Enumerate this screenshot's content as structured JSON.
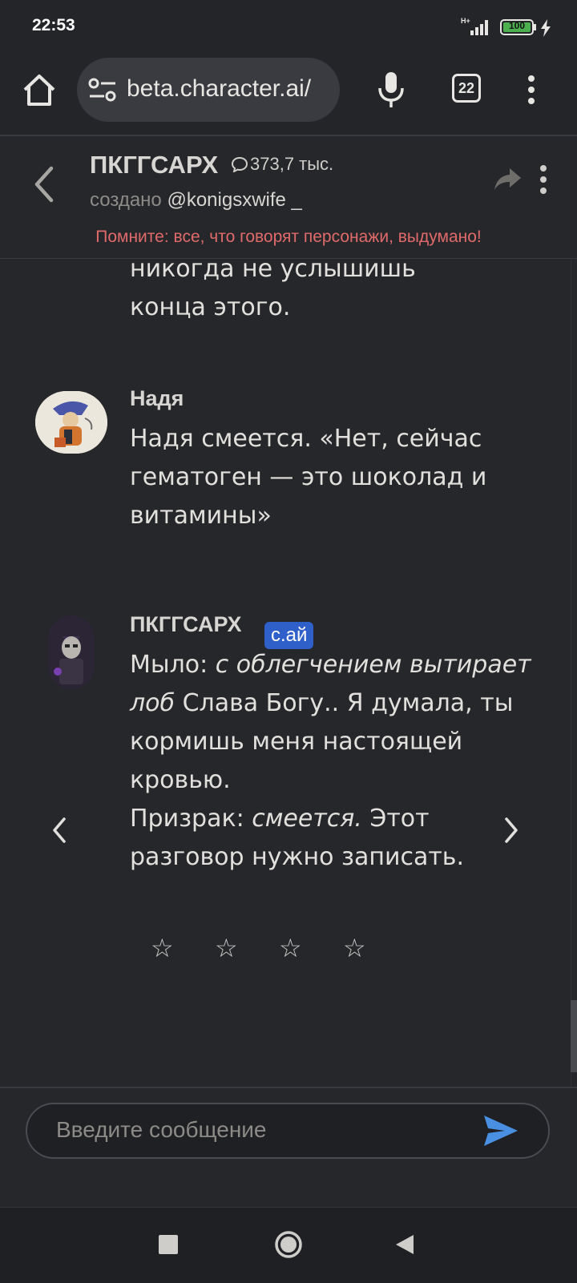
{
  "status_bar": {
    "time": "22:53",
    "network": "H+",
    "battery": "100"
  },
  "browser": {
    "url": "beta.character.ai/",
    "tab_count": "22"
  },
  "chat_header": {
    "character_name": "ПКГГСАРХ",
    "chat_count": "373,7 тыс.",
    "creator_prefix": "создано",
    "creator_handle": "@konigsxwife _",
    "disclaimer": "Помните: все, что говорят персонажи, выдумано!"
  },
  "messages": {
    "partial_top": {
      "line1": "никогда не услышишь",
      "line2": "конца этого."
    },
    "user_message": {
      "sender": "Надя",
      "line1": "Надя смеется. «Нет, сейчас",
      "line2": "гематоген — это шоколад и",
      "line3": "витамины»"
    },
    "bot_message": {
      "sender": "ПКГГСАРХ",
      "badge": "c.ай",
      "l1_plain": "Мыло: ",
      "l1_italic": "с облегчением вытирает",
      "l2_italic": "лоб",
      "l2_plain": " Слава Богу.. Я думала, ты",
      "l3": "кормишь меня настоящей",
      "l4": "кровью.",
      "l5_plain": "Призрак: ",
      "l5_italic": "смеется.",
      "l5_rest": " Этот",
      "l6": "разговор нужно записать."
    },
    "rating": {
      "star": "☆",
      "max": 4,
      "value": 0
    }
  },
  "composer": {
    "placeholder": "Введите сообщение"
  },
  "colors": {
    "background": "#26272b",
    "accent_send": "#4a90e2",
    "badge": "#2f5fc9",
    "disclaimer": "#e06a6a",
    "battery": "#4caf50"
  },
  "icons": [
    "home-icon",
    "tune-icon",
    "mic-icon",
    "tabs-icon",
    "more-vert-icon",
    "back-arrow-icon",
    "chat-bubble-icon",
    "share-icon",
    "chevron-left-icon",
    "chevron-right-icon",
    "star-icon",
    "send-icon"
  ]
}
